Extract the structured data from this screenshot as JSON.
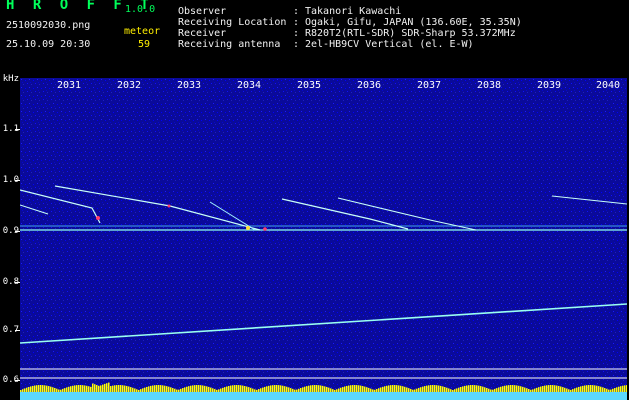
{
  "app": {
    "title": "H R O F F T",
    "version": "1.0.0",
    "file_name": "2510092030.png",
    "datetime": "25.10.09 20:30",
    "meteor_label": "meteor",
    "meteor_count": "59"
  },
  "info": [
    {
      "label": "Observer",
      "value": "Takanori Kawachi"
    },
    {
      "label": "Receiving Location",
      "value": "Ogaki, Gifu, JAPAN (136.60E, 35.35N)"
    },
    {
      "label": "Receiver",
      "value": "R820T2(RTL-SDR) SDR-Sharp 53.372MHz"
    },
    {
      "label": "Receiving antenna",
      "value": "2el-HB9CV Vertical (el. E-W)"
    }
  ],
  "spectrum": {
    "unit_label": "kHz",
    "y_ticks": [
      "1.1",
      "1.0",
      "0.9",
      "0.8",
      "0.7",
      "0.6"
    ],
    "time_ticks": [
      "2031",
      "2032",
      "2033",
      "2034",
      "2035",
      "2036",
      "2037",
      "2038",
      "2039",
      "2040"
    ],
    "colors": {
      "background": "#0a0a9a",
      "signal_line": "#a0fff0",
      "reference_line": "#ffffff",
      "histogram": "#ffff00",
      "histogram_bottom": "#5ad8ff"
    }
  }
}
